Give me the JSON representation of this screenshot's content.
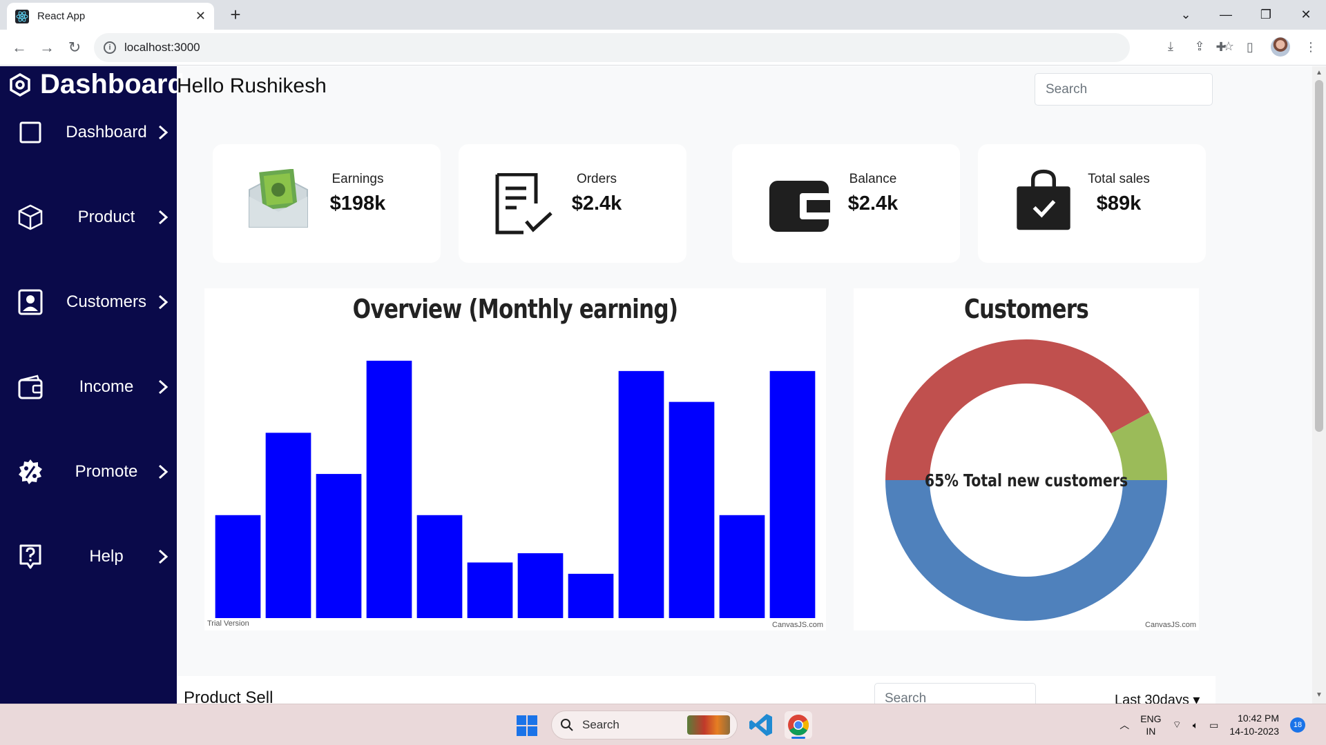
{
  "browser": {
    "tab_title": "React App",
    "url": "localhost:3000"
  },
  "sidebar": {
    "brand": "Dashboard",
    "items": [
      {
        "label": "Dashboard",
        "icon": "square-icon"
      },
      {
        "label": "Product",
        "icon": "box-icon"
      },
      {
        "label": "Customers",
        "icon": "person-badge-icon"
      },
      {
        "label": "Income",
        "icon": "wallet-icon"
      },
      {
        "label": "Promote",
        "icon": "discount-badge-icon"
      },
      {
        "label": "Help",
        "icon": "help-icon"
      }
    ]
  },
  "header": {
    "greeting": "Hello Rushikesh",
    "search_placeholder": "Search"
  },
  "stats": [
    {
      "label": "Earnings",
      "value": "$198k",
      "icon": "money-envelope-icon"
    },
    {
      "label": "Orders",
      "value": "$2.4k",
      "icon": "clipboard-check-icon"
    },
    {
      "label": "Balance",
      "value": "$2.4k",
      "icon": "wallet-icon"
    },
    {
      "label": "Total sales",
      "value": "$89k",
      "icon": "shopping-bag-check-icon"
    }
  ],
  "overview_chart": {
    "credit": "CanvasJS.com",
    "trial": "Trial Version"
  },
  "customers_chart": {
    "credit": "CanvasJS.com"
  },
  "chart_data": [
    {
      "type": "bar",
      "title": "Overview (Monthly earning)",
      "values": [
        1.0,
        1.8,
        1.4,
        2.5,
        1.0,
        0.54,
        0.63,
        0.43,
        2.4,
        2.1,
        1.0,
        2.4
      ],
      "ylim": [
        0,
        2.6
      ],
      "color": "#0000ff",
      "grid": false
    },
    {
      "type": "pie",
      "title": "Customers",
      "center_label": "65% Total new customers",
      "values": [
        42,
        8,
        50
      ],
      "colors": [
        "#c0504e",
        "#9bbb59",
        "#4f81bc"
      ],
      "donut": true
    }
  ],
  "product_sell": {
    "title": "Product Sell",
    "search_placeholder": "Search",
    "range": "Last 30days"
  },
  "taskbar": {
    "search": "Search",
    "lang_1": "ENG",
    "lang_2": "IN",
    "time": "10:42 PM",
    "date": "14-10-2023",
    "notifications": "18"
  }
}
